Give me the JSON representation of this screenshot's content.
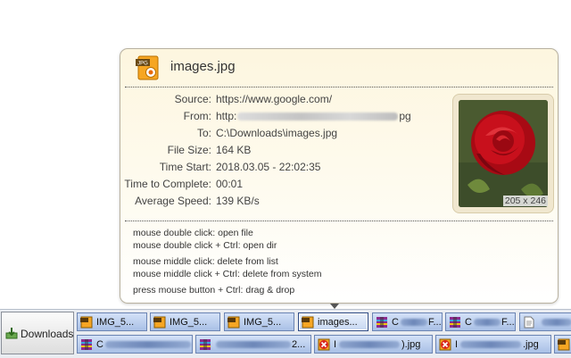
{
  "popup": {
    "title": "images.jpg",
    "file_icon": "jpg-file-icon",
    "fields": [
      {
        "label": "Source:",
        "value": "https://www.google.com/"
      },
      {
        "label": "From:",
        "value_prefix": "http:",
        "value_suffix": "pg"
      },
      {
        "label": "To:",
        "value": "C:\\Downloads\\images.jpg"
      },
      {
        "label": "File Size:",
        "value": "164 KB"
      },
      {
        "label": "Time Start:",
        "value": "2018.03.05 - 22:02:35"
      },
      {
        "label": "Time to Complete:",
        "value": "00:01"
      },
      {
        "label": "Average Speed:",
        "value": "139 KB/s"
      }
    ],
    "thumbnail": {
      "size_label": "205 x 246",
      "subject": "red rose"
    },
    "hints": [
      "mouse double click: open file",
      "mouse double click + Ctrl: open dir",
      "mouse middle click: delete from list",
      "mouse middle click + Ctrl: delete from system",
      "press mouse button + Ctrl: drag & drop"
    ]
  },
  "downloads_bar": {
    "button_label": "Downloads",
    "row1": [
      {
        "label": "IMG_5...",
        "icon": "jpg-file-icon"
      },
      {
        "label": "IMG_5...",
        "icon": "jpg-file-icon"
      },
      {
        "label": "IMG_5...",
        "icon": "jpg-file-icon"
      },
      {
        "label": "images...",
        "icon": "jpg-file-icon",
        "active": true
      },
      {
        "label": "C",
        "label_suffix": "F...",
        "icon": "archive-icon"
      },
      {
        "label": "C",
        "label_suffix": "F...",
        "icon": "archive-icon"
      },
      {
        "label": "",
        "icon": "document-icon"
      }
    ],
    "row2": [
      {
        "label": "C",
        "label_suffix": "",
        "icon": "archive-icon"
      },
      {
        "label": "",
        "label_suffix": "2...",
        "icon": "archive-icon"
      },
      {
        "label": "I",
        "label_suffix": ").jpg",
        "icon": "error-file-icon"
      },
      {
        "label": "I",
        "label_suffix": ".jpg",
        "icon": "error-file-icon"
      },
      {
        "label": "",
        "icon": "jpg-file-icon"
      }
    ]
  },
  "colors": {
    "accent_blue": "#a9c0e6",
    "popup_bg": "#fdf6df",
    "rose_red": "#c8101c"
  }
}
